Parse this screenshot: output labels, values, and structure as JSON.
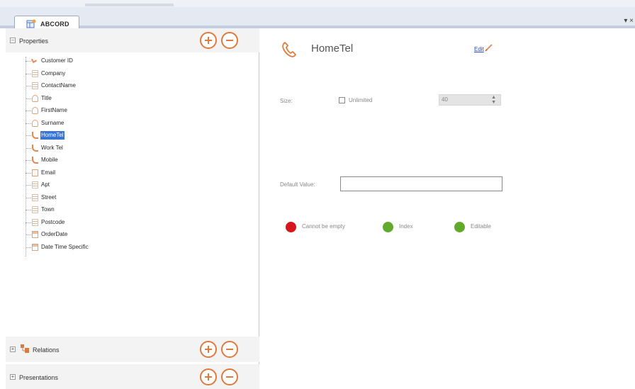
{
  "tab": {
    "label": "ABCORD",
    "controls": "▾ ×"
  },
  "left_panel": {
    "properties_header": "Properties",
    "relations_header": "Relations",
    "presentations_header": "Presentations",
    "tree_items": [
      {
        "label": "Customer ID",
        "icon": "key-icon"
      },
      {
        "label": "Company",
        "icon": "text-field-icon"
      },
      {
        "label": "ContactName",
        "icon": "text-field-icon"
      },
      {
        "label": "Title",
        "icon": "person-icon"
      },
      {
        "label": "FirstName",
        "icon": "person-icon"
      },
      {
        "label": "Surname",
        "icon": "person-icon"
      },
      {
        "label": "HomeTel",
        "icon": "phone-icon",
        "selected": true
      },
      {
        "label": "Work Tel",
        "icon": "phone-icon"
      },
      {
        "label": "Mobile",
        "icon": "phone-icon"
      },
      {
        "label": "Email",
        "icon": "mail-icon"
      },
      {
        "label": "Apt",
        "icon": "text-field-icon"
      },
      {
        "label": "Street",
        "icon": "text-field-icon"
      },
      {
        "label": "Town",
        "icon": "text-field-icon"
      },
      {
        "label": "Postcode",
        "icon": "text-field-icon"
      },
      {
        "label": "OrderDate",
        "icon": "calendar-icon"
      },
      {
        "label": "Date Time Specific",
        "icon": "calendar-icon"
      }
    ]
  },
  "detail": {
    "field_name": "HomeTel",
    "edit_label": "Edit",
    "size_label": "Size:",
    "unlimited_label": "Unlimited",
    "size_value": "40",
    "default_value_label": "Default Value:",
    "default_value": "",
    "flags": [
      {
        "label": "Cannot be empty",
        "color": "#d8141c"
      },
      {
        "label": "Index",
        "color": "#62aa2c"
      },
      {
        "label": "Editable",
        "color": "#62aa2c"
      }
    ]
  },
  "colors": {
    "accent": "#e07a3c",
    "selection": "#3874d8",
    "link": "#1a4ccf"
  }
}
